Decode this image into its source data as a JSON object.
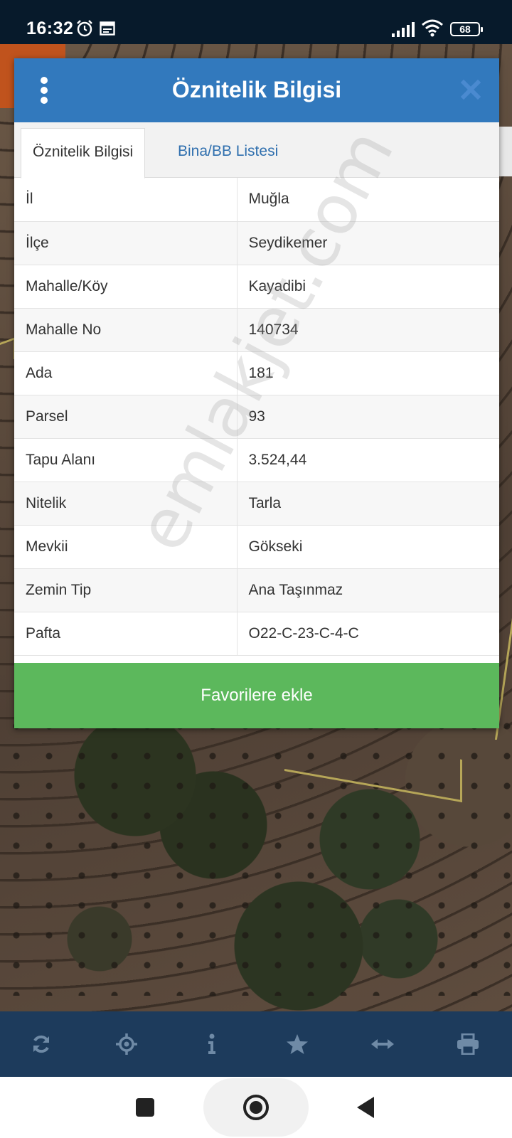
{
  "status_bar": {
    "time": "16:32",
    "battery": "68"
  },
  "dialog": {
    "title": "Öznitelik Bilgisi",
    "tabs": [
      {
        "label": "Öznitelik Bilgisi",
        "active": true
      },
      {
        "label": "Bina/BB Listesi",
        "active": false
      }
    ],
    "rows": [
      {
        "key": "İl",
        "value": "Muğla"
      },
      {
        "key": "İlçe",
        "value": "Seydikemer"
      },
      {
        "key": "Mahalle/Köy",
        "value": "Kayadibi"
      },
      {
        "key": "Mahalle No",
        "value": "140734"
      },
      {
        "key": "Ada",
        "value": "181"
      },
      {
        "key": "Parsel",
        "value": "93"
      },
      {
        "key": "Tapu Alanı",
        "value": "3.524,44"
      },
      {
        "key": "Nitelik",
        "value": "Tarla"
      },
      {
        "key": "Mevkii",
        "value": "Gökseki"
      },
      {
        "key": "Zemin Tip",
        "value": "Ana Taşınmaz"
      },
      {
        "key": "Pafta",
        "value": "O22-C-23-C-4-C"
      }
    ],
    "favorite_button": "Favorilere ekle"
  },
  "watermark": "emlakjet.com",
  "toolbar": {
    "icons": [
      "refresh-icon",
      "locate-icon",
      "info-icon",
      "star-icon",
      "measure-icon",
      "print-icon"
    ]
  },
  "colors": {
    "header": "#3279bd",
    "favorite": "#5cb85c",
    "toolbar": "#1d3b5c",
    "tab_link": "#2f6fae"
  }
}
